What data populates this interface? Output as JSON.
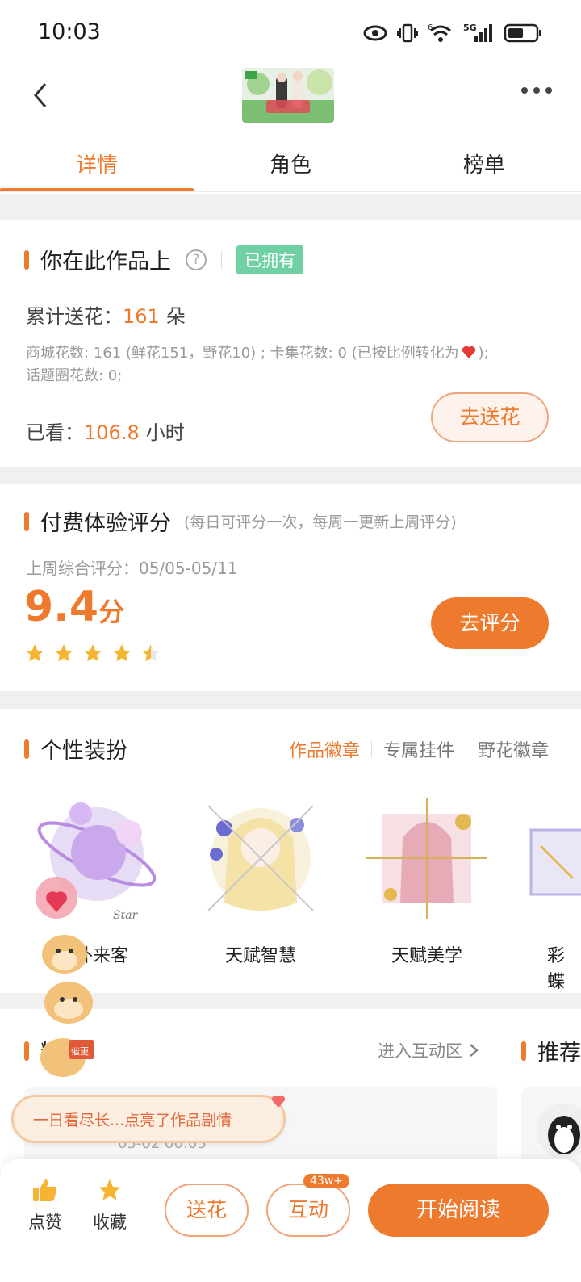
{
  "status_bar": {
    "time": "10:03",
    "network": "5G",
    "wifi_sub": "6"
  },
  "header": {
    "tabs": [
      {
        "label": "详情",
        "active": true
      },
      {
        "label": "角色",
        "active": false
      },
      {
        "label": "榜单",
        "active": false
      }
    ]
  },
  "ownership": {
    "title": "你在此作品上",
    "owned_badge": "已拥有",
    "total_flowers_label": "累计送花：",
    "total_flowers_value": "161",
    "total_flowers_unit": "朵",
    "detail_line1": "商城花数: 161 (鲜花151，野花10) ; 卡集花数: 0 (已按比例转化为",
    "detail_line1_end": ");",
    "detail_line2": "话题圈花数: 0;",
    "watched_label": "已看：",
    "watched_value": "106.8",
    "watched_unit": "小时",
    "send_flower_button": "去送花"
  },
  "rating": {
    "title": "付费体验评分",
    "subtitle": "(每日可评分一次，每周一更新上周评分)",
    "last_week_label": "上周综合评分：05/05-05/11",
    "score": "9.4",
    "score_unit": "分",
    "stars": 4.5,
    "rate_button": "去评分"
  },
  "decor": {
    "title": "个性装扮",
    "subtabs": [
      "作品徽章",
      "专属挂件",
      "野花徽章"
    ],
    "badges": [
      "天外来客",
      "天赋智慧",
      "天赋美学",
      "彩蝶"
    ]
  },
  "featured": {
    "title": "精选",
    "enter_link": "进入互动区",
    "recommend_title": "推荐",
    "toast": "一日看尽长...点亮了作品剧情",
    "timestamp": "05-02 00:05",
    "stamp_text": "催更"
  },
  "bottom_bar": {
    "like": "点赞",
    "favorite": "收藏",
    "send_flower": "送花",
    "interact": "互动",
    "interact_badge": "43w+",
    "start_reading": "开始阅读"
  },
  "colors": {
    "accent": "#ee7a2e",
    "owned": "#6fd0a4",
    "star": "#f5b431"
  }
}
